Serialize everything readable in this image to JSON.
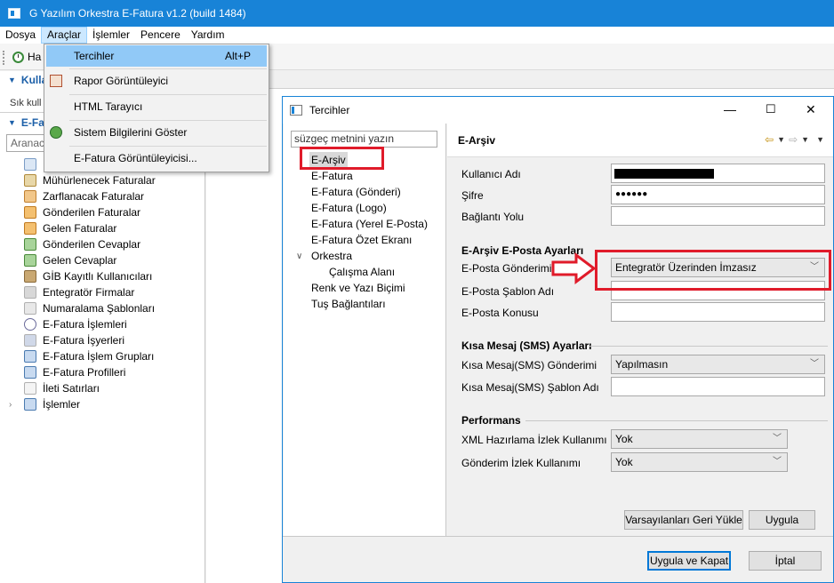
{
  "app": {
    "title": "G Yazılım Orkestra E-Fatura v1.2 (build 1484)",
    "menu": [
      "Dosya",
      "Araçlar",
      "İşlemler",
      "Pencere",
      "Yardım"
    ]
  },
  "toolbar": {
    "ha_label": "Ha"
  },
  "left_panel": {
    "section1": "Kulla",
    "sik_text": "Sık kull",
    "section2": "E-Fatu",
    "search_placeholder": "Aranac",
    "tree": [
      "",
      "Mühürlenecek Faturalar",
      "Zarflanacak Faturalar",
      "Gönderilen Faturalar",
      "Gelen Faturalar",
      "Gönderilen Cevaplar",
      "Gelen Cevaplar",
      "GİB Kayıtlı Kullanıcıları",
      "Entegratör Firmalar",
      "Numaralama Şablonları",
      "E-Fatura İşlemleri",
      "E-Fatura İşyerleri",
      "E-Fatura İşlem Grupları",
      "E-Fatura Profilleri",
      "İleti Satırları",
      "İşlemler"
    ]
  },
  "araclar_menu": {
    "items": [
      {
        "label": "Tercihler",
        "shortcut": "Alt+P"
      },
      {
        "label": "Rapor Görüntüleyici",
        "shortcut": ""
      },
      {
        "label": "HTML Tarayıcı",
        "shortcut": ""
      },
      {
        "label": "Sistem Bilgilerini Göster",
        "shortcut": ""
      },
      {
        "label": "E-Fatura Görüntüleyicisi...",
        "shortcut": ""
      }
    ]
  },
  "dialog": {
    "title": "Tercihler",
    "filter_value": "süzgeç metnini yazın",
    "nav": [
      "E-Arşiv",
      "E-Fatura",
      "E-Fatura (Gönderi)",
      "E-Fatura (Logo)",
      "E-Fatura (Yerel E-Posta)",
      "E-Fatura Özet Ekranı",
      "Orkestra",
      "Çalışma Alanı",
      "Renk ve Yazı Biçimi",
      "Tuş Bağlantıları"
    ],
    "page_title": "E-Arşiv",
    "fields": {
      "kullanici_adi": "Kullanıcı Adı",
      "sifre": "Şifre",
      "sifre_value": "●●●●●●",
      "baglanti_yolu": "Bağlantı Yolu"
    },
    "eposta_group": {
      "title": "E-Arşiv E-Posta Ayarları",
      "gonderim_label": "E-Posta Gönderimi",
      "gonderim_value": "Entegratör Üzerinden İmzasız",
      "sablon_label": "E-Posta Şablon Adı",
      "konu_label": "E-Posta Konusu"
    },
    "sms_group": {
      "title": "Kısa Mesaj (SMS) Ayarları",
      "gonderim_label": "Kısa Mesaj(SMS) Gönderimi",
      "gonderim_value": "Yapılmasın",
      "sablon_label": "Kısa Mesaj(SMS) Şablon Adı"
    },
    "perf_group": {
      "title": "Performans",
      "xml_label": "XML Hazırlama İzlek Kullanımı",
      "xml_value": "Yok",
      "gonderim_label": "Gönderim İzlek Kullanımı",
      "gonderim_value": "Yok"
    },
    "buttons": {
      "defaults": "Varsayılanları Geri Yükle",
      "apply": "Uygula",
      "apply_close": "Uygula ve Kapat",
      "cancel": "İptal"
    }
  },
  "colors": {
    "titlebar": "#1883d7",
    "highlight_box": "#e01b2a",
    "menu_highlight": "#91c9f7"
  }
}
